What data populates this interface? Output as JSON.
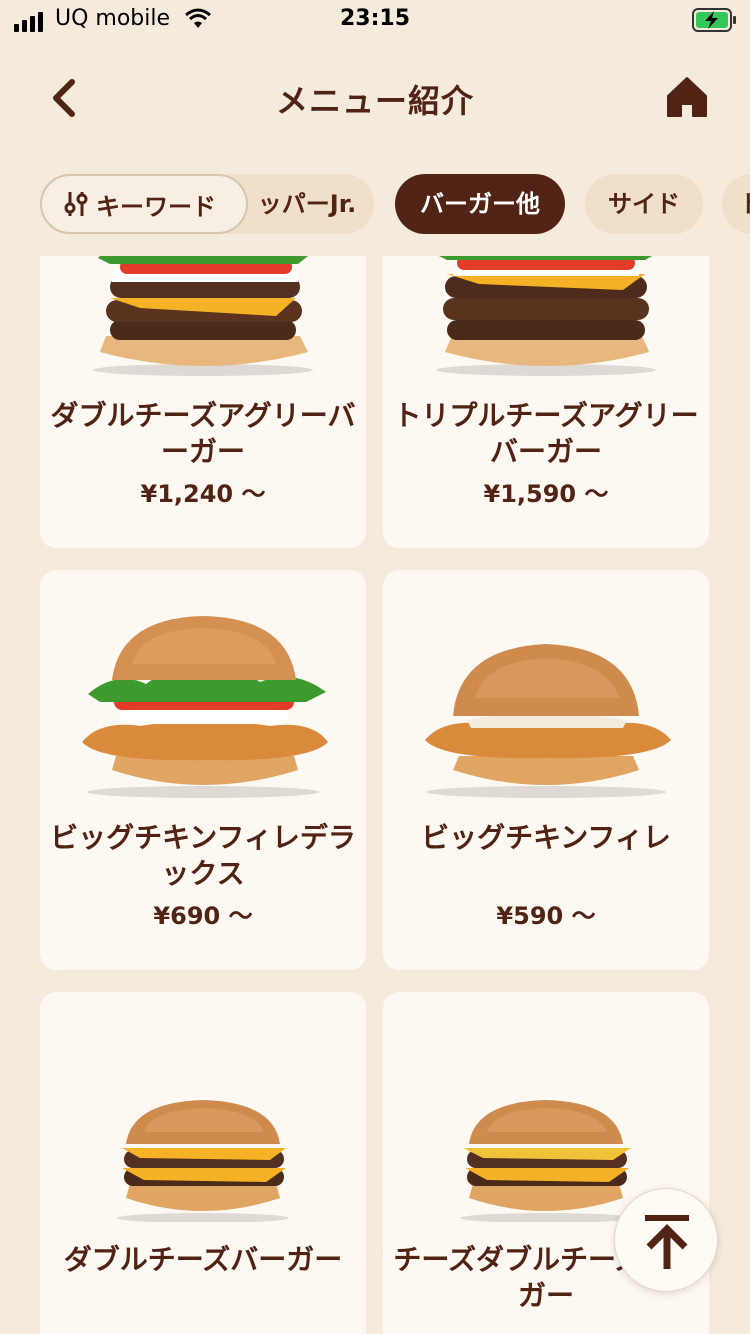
{
  "status_bar": {
    "carrier": "UQ mobile",
    "time": "23:15"
  },
  "header": {
    "title": "メニュー紹介",
    "back_icon": "chevron-left-icon",
    "home_icon": "home-icon"
  },
  "keyword_button": {
    "label": "キーワード",
    "icon": "sliders-icon"
  },
  "tabs": [
    {
      "label": "ッパーJr."
    },
    {
      "label": "バーガー他",
      "active": true
    },
    {
      "label": "サイド"
    },
    {
      "label": "ド"
    }
  ],
  "menu_items": [
    {
      "name": "ダブルチーズアグリーバーガー",
      "price": "¥1,240 ～"
    },
    {
      "name": "トリプルチーズアグリーバーガー",
      "price": "¥1,590 ～"
    },
    {
      "name": "ビッグチキンフィレデラックス",
      "price": "¥690 ～"
    },
    {
      "name": "ビッグチキンフィレ",
      "price": "¥590 ～"
    },
    {
      "name": "ダブルチーズバーガー",
      "price": ""
    },
    {
      "name": "チーズダブルチーズバーガー",
      "price": ""
    }
  ],
  "scroll_top_icon": "arrow-up-to-top-icon",
  "colors": {
    "background": "#f5ebdc",
    "brand_brown": "#502314",
    "card": "#fdf8f2",
    "tab": "#f0dfc9"
  }
}
